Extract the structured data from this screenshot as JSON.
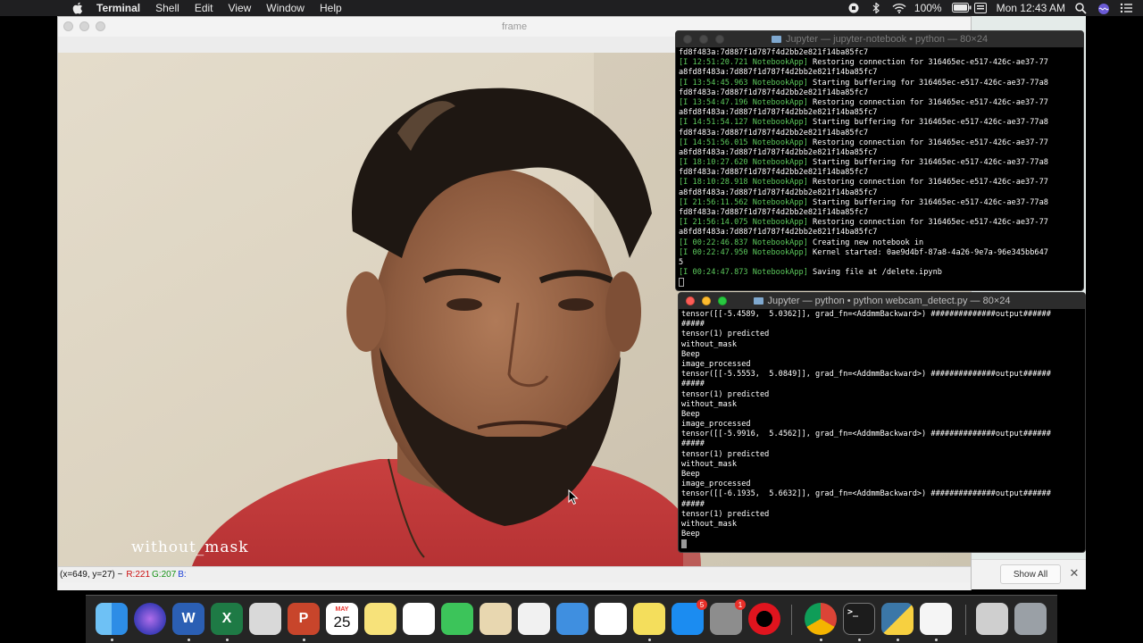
{
  "menubar": {
    "app_name": "Terminal",
    "menus": [
      "Shell",
      "Edit",
      "View",
      "Window",
      "Help"
    ],
    "battery": "100%",
    "clock": "Mon 12:43 AM"
  },
  "frame_window": {
    "title": "frame",
    "overlay_label": "without_mask",
    "status": {
      "coords": "(x=649, y=27) ~",
      "r": "R:221",
      "g": "G:207",
      "b": "B:"
    }
  },
  "downloads_bar": {
    "show_all_label": "Show All",
    "close_glyph": "✕"
  },
  "terminal1": {
    "title": "Jupyter — jupyter-notebook • python — 80×24",
    "lines": [
      {
        "ts": "",
        "text": "fd8f483a:7d887f1d787f4d2bb2e821f14ba85fc7"
      },
      {
        "ts": "[I 12:51:20.721 NotebookApp]",
        "text": " Restoring connection for 316465ec-e517-426c-ae37-77"
      },
      {
        "ts": "",
        "text": "a8fd8f483a:7d887f1d787f4d2bb2e821f14ba85fc7"
      },
      {
        "ts": "[I 13:54:45.963 NotebookApp]",
        "text": " Starting buffering for 316465ec-e517-426c-ae37-77a8"
      },
      {
        "ts": "",
        "text": "fd8f483a:7d887f1d787f4d2bb2e821f14ba85fc7"
      },
      {
        "ts": "[I 13:54:47.196 NotebookApp]",
        "text": " Restoring connection for 316465ec-e517-426c-ae37-77"
      },
      {
        "ts": "",
        "text": "a8fd8f483a:7d887f1d787f4d2bb2e821f14ba85fc7"
      },
      {
        "ts": "[I 14:51:54.127 NotebookApp]",
        "text": " Starting buffering for 316465ec-e517-426c-ae37-77a8"
      },
      {
        "ts": "",
        "text": "fd8f483a:7d887f1d787f4d2bb2e821f14ba85fc7"
      },
      {
        "ts": "[I 14:51:56.015 NotebookApp]",
        "text": " Restoring connection for 316465ec-e517-426c-ae37-77"
      },
      {
        "ts": "",
        "text": "a8fd8f483a:7d887f1d787f4d2bb2e821f14ba85fc7"
      },
      {
        "ts": "[I 18:10:27.620 NotebookApp]",
        "text": " Starting buffering for 316465ec-e517-426c-ae37-77a8"
      },
      {
        "ts": "",
        "text": "fd8f483a:7d887f1d787f4d2bb2e821f14ba85fc7"
      },
      {
        "ts": "[I 18:10:28.918 NotebookApp]",
        "text": " Restoring connection for 316465ec-e517-426c-ae37-77"
      },
      {
        "ts": "",
        "text": "a8fd8f483a:7d887f1d787f4d2bb2e821f14ba85fc7"
      },
      {
        "ts": "[I 21:56:11.562 NotebookApp]",
        "text": " Starting buffering for 316465ec-e517-426c-ae37-77a8"
      },
      {
        "ts": "",
        "text": "fd8f483a:7d887f1d787f4d2bb2e821f14ba85fc7"
      },
      {
        "ts": "[I 21:56:14.075 NotebookApp]",
        "text": " Restoring connection for 316465ec-e517-426c-ae37-77"
      },
      {
        "ts": "",
        "text": "a8fd8f483a:7d887f1d787f4d2bb2e821f14ba85fc7"
      },
      {
        "ts": "[I 00:22:46.837 NotebookApp]",
        "text": " Creating new notebook in"
      },
      {
        "ts": "[I 00:22:47.950 NotebookApp]",
        "text": " Kernel started: 0ae9d4bf-87a8-4a26-9e7a-96e345bb647"
      },
      {
        "ts": "",
        "text": "5"
      },
      {
        "ts": "[I 00:24:47.873 NotebookApp]",
        "text": " Saving file at /delete.ipynb"
      }
    ]
  },
  "terminal2": {
    "title": "Jupyter — python • python webcam_detect.py — 80×24",
    "lines": [
      "tensor([[-5.4589,  5.0362]], grad_fn=<AddmmBackward>) ##############output######",
      "#####",
      "tensor(1) predicted",
      "without_mask",
      "Beep",
      "image_processed",
      "tensor([[-5.5553,  5.0849]], grad_fn=<AddmmBackward>) ##############output######",
      "#####",
      "tensor(1) predicted",
      "without_mask",
      "Beep",
      "image_processed",
      "tensor([[-5.9916,  5.4562]], grad_fn=<AddmmBackward>) ##############output######",
      "#####",
      "tensor(1) predicted",
      "without_mask",
      "Beep",
      "image_processed",
      "tensor([[-6.1935,  5.6632]], grad_fn=<AddmmBackward>) ##############output######",
      "#####",
      "tensor(1) predicted",
      "without_mask",
      "Beep"
    ]
  },
  "dock": {
    "calendar_month": "MAY",
    "calendar_day": "25",
    "appstore_badge": "5",
    "sysprefs_badge": "1",
    "word_letter": "W",
    "excel_letter": "X",
    "ppt_letter": "P",
    "terminal_prompt": ">_",
    "icons": [
      "finder-icon",
      "siri-icon",
      "word-icon",
      "excel-icon",
      "screenshot-icon",
      "powerpoint-icon",
      "calendar-icon",
      "notes-icon",
      "reminders-icon",
      "facetime-icon",
      "preview-icon",
      "numbers-icon",
      "keynote-icon",
      "textedit-icon",
      "stickies-icon",
      "app-store-icon",
      "system-preferences-icon",
      "opera-icon",
      "chrome-icon",
      "terminal-icon",
      "python-icon",
      "document-icon",
      "music-icon",
      "trash-icon"
    ]
  }
}
